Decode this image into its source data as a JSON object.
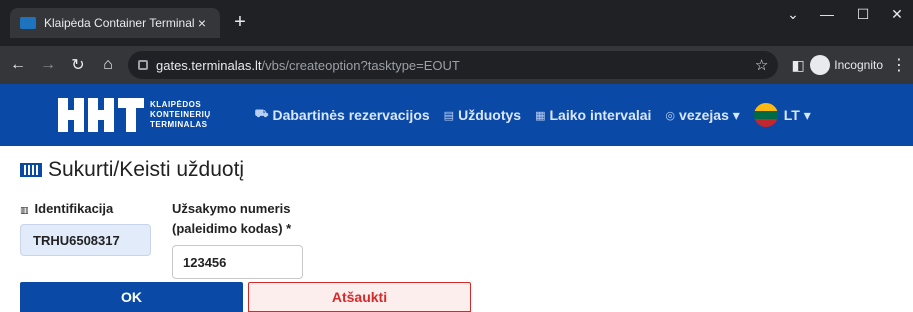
{
  "browser": {
    "tab_title": "Klaipėda Container Terminal",
    "tab_close": "×",
    "new_tab": "+",
    "url_host": "gates.terminalas.lt",
    "url_path": "/vbs/createoption?tasktype=EOUT",
    "incognito_label": "Incognito",
    "win_minimize": "—",
    "win_restore": "☐",
    "win_close": "✕",
    "dropdown": "⌄"
  },
  "navbar": {
    "logo_lines": [
      "KLAIPĖDOS",
      "KONTEINERIŲ",
      "TERMINALAS"
    ],
    "items": [
      {
        "icon": "⛟",
        "label": "Dabartinės rezervacijos"
      },
      {
        "icon": "▤",
        "label": "Užduotys"
      },
      {
        "icon": "▦",
        "label": "Laiko intervalai"
      },
      {
        "icon": "◎",
        "label": "vezejas ▾"
      }
    ],
    "language": "LT ▾",
    "flag_colors": [
      "#fdb913",
      "#006a44",
      "#c1272d"
    ]
  },
  "page": {
    "title": "Sukurti/Keisti užduotį",
    "identification_label": "Identifikacija",
    "identification_value": "TRHU6508317",
    "order_label_line1": "Užsakymo numeris",
    "order_label_line2": "(paleidimo kodas) *",
    "order_value": "123456",
    "ok_label": "OK",
    "cancel_label": "Atšaukti"
  },
  "colors": {
    "brand": "#0a4aa6",
    "cancel": "#d42a2a"
  }
}
